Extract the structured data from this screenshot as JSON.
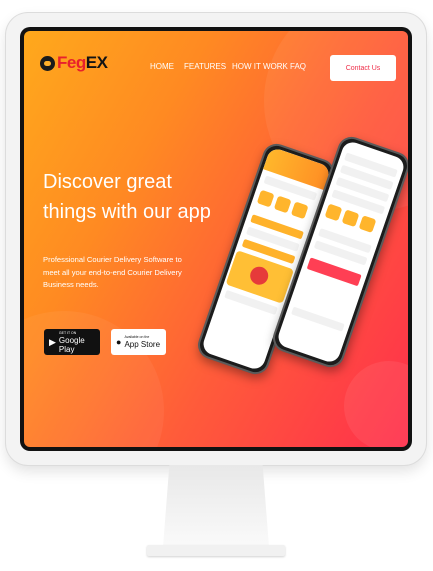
{
  "brand": {
    "prefix": "Feg",
    "suffix": "EX"
  },
  "nav": {
    "items": [
      {
        "label": "HOME"
      },
      {
        "label": "FEATURES"
      },
      {
        "label": "HOW IT WORK"
      },
      {
        "label": "FAQ"
      }
    ],
    "contact_label": "Contact Us"
  },
  "hero": {
    "title_line1": "Discover great",
    "title_line2": "things with our app",
    "description": "Professional Courier Delivery Software to meet all your end-to-end Courier Delivery Business needs."
  },
  "stores": {
    "google": {
      "small": "GET IT ON",
      "big": "Google Play",
      "icon": "play-icon"
    },
    "apple": {
      "small": "Available on the",
      "big": "App Store",
      "icon": "apple-icon"
    }
  },
  "colors": {
    "gradient_start": "#ffa91c",
    "gradient_end": "#ff2f4c",
    "brand_red": "#e8202c",
    "contact_text": "#ef2f4a"
  }
}
